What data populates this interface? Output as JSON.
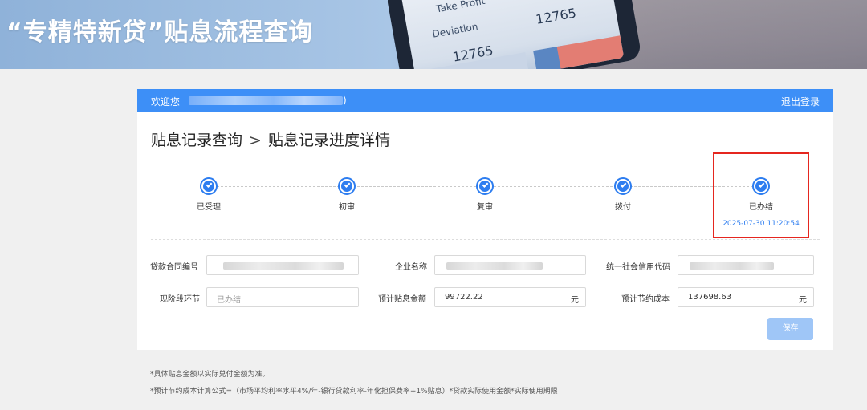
{
  "banner": {
    "title": "“专精特新贷”贴息流程查询",
    "phone_texts": [
      "Take Profit",
      "Deviation",
      "12765",
      "12765"
    ]
  },
  "header": {
    "welcome": "欢迎您",
    "name_suffix": ")",
    "logout": "退出登录"
  },
  "breadcrumb": {
    "root": "贴息记录查询",
    "separator": ">",
    "current": "贴息记录进度详情"
  },
  "steps": [
    {
      "label": "已受理"
    },
    {
      "label": "初审"
    },
    {
      "label": "复审"
    },
    {
      "label": "拨付"
    },
    {
      "label": "已办结",
      "time": "2025-07-30 11:20:54"
    }
  ],
  "form": {
    "contract_no": {
      "label": "贷款合同编号"
    },
    "company_name": {
      "label": "企业名称"
    },
    "credit_code": {
      "label": "统一社会信用代码"
    },
    "current_stage": {
      "label": "现阶段环节",
      "value": "已办结"
    },
    "subsidy_amount": {
      "label": "预计贴息金额",
      "value": "99722.22",
      "unit": "元"
    },
    "cost_savings": {
      "label": "预计节约成本",
      "value": "137698.63",
      "unit": "元"
    },
    "save_label": "保存"
  },
  "notes": [
    "*具体贴息金额以实际兑付金额为准。",
    "*预计节约成本计算公式=（市场平均利率水平4%/年-银行贷款利率-年化担保费率+1%贴息）*贷款实际使用金额*实际使用期限"
  ],
  "colors": {
    "primary": "#3d8ff7",
    "step_done": "#2d7df0",
    "highlight_box": "#e5261f",
    "save_button": "#9fc6f7"
  }
}
